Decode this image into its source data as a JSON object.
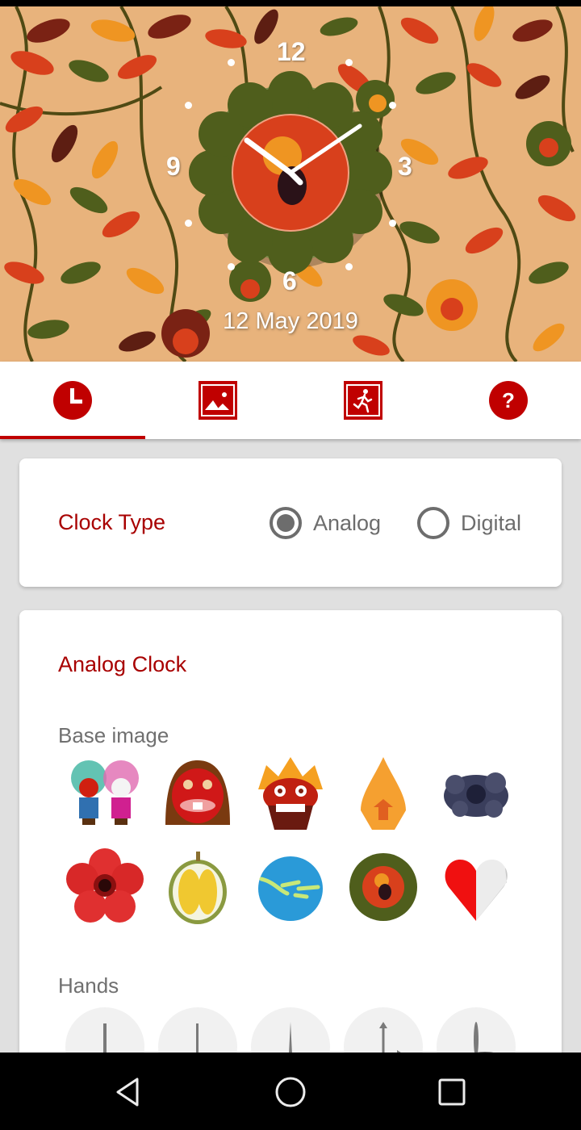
{
  "clock_preview": {
    "numerals": {
      "twelve": "12",
      "three": "3",
      "six": "6",
      "nine": "9"
    },
    "date": "12 May 2019",
    "colors": {
      "background": "#e8b37c",
      "leaf_red": "#d8401c",
      "leaf_orange": "#ef9522",
      "leaf_green": "#4f5e1c",
      "leaf_brown": "#5d1e12",
      "vine": "#4f4a14"
    }
  },
  "tabs": [
    {
      "name": "clock",
      "icon": "clock-icon",
      "selected": true
    },
    {
      "name": "wallpaper",
      "icon": "image-icon",
      "selected": false
    },
    {
      "name": "activity",
      "icon": "running-man-icon",
      "selected": false
    },
    {
      "name": "help",
      "icon": "question-icon",
      "selected": false
    }
  ],
  "accent_color": "#c00000",
  "clock_type": {
    "label": "Clock Type",
    "options": [
      {
        "label": "Analog",
        "selected": true
      },
      {
        "label": "Digital",
        "selected": false
      }
    ]
  },
  "analog_clock": {
    "title": "Analog Clock",
    "base_image_label": "Base image",
    "base_images": [
      {
        "name": "ondel-ondel"
      },
      {
        "name": "red-mask"
      },
      {
        "name": "barong-mask"
      },
      {
        "name": "gunungan"
      },
      {
        "name": "mega-mendung-cloud"
      },
      {
        "name": "rafflesia"
      },
      {
        "name": "durian"
      },
      {
        "name": "indonesia-globe"
      },
      {
        "name": "batik-flower"
      },
      {
        "name": "red-white-heart"
      }
    ],
    "hands_label": "Hands",
    "hands": [
      {
        "name": "hands-style-1"
      },
      {
        "name": "hands-style-2"
      },
      {
        "name": "hands-style-3"
      },
      {
        "name": "hands-style-4-arrows"
      },
      {
        "name": "hands-style-5"
      }
    ]
  },
  "navbar": {
    "back": "back-icon",
    "home": "home-icon",
    "recents": "recents-icon"
  }
}
